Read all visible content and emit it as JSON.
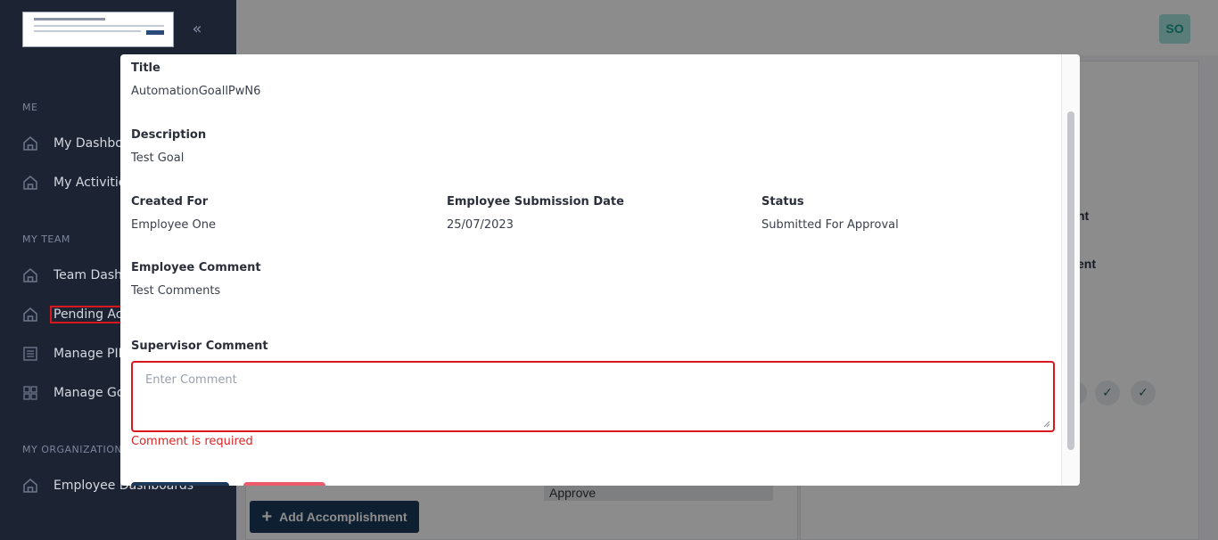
{
  "sidebar": {
    "sections": {
      "me": "ME",
      "my_team": "MY TEAM",
      "my_org": "MY ORGANIZATION"
    },
    "items": [
      {
        "label": "My Dashboard",
        "icon": "home-icon"
      },
      {
        "label": "My Activities",
        "icon": "home-icon"
      },
      {
        "label": "Team Dashboard",
        "icon": "home-icon"
      },
      {
        "label": "Pending Actions",
        "icon": "home-icon"
      },
      {
        "label": "Manage PIP",
        "icon": "list-icon"
      },
      {
        "label": "Manage Goals",
        "icon": "grid-icon"
      },
      {
        "label": "Employee Dashboards",
        "icon": "home-icon"
      }
    ],
    "collapse_glyph": "«"
  },
  "header": {
    "avatar_initials": "SO"
  },
  "background": {
    "frag_1": "nt",
    "frag_2": "ent",
    "approve_label": "Approve",
    "add_accomplishment_label": "Add Accomplishment",
    "plus_glyph": "+"
  },
  "modal": {
    "title_label": "Title",
    "title_value": "AutomationGoallPwN6",
    "description_label": "Description",
    "description_value": "Test Goal",
    "created_for_label": "Created For",
    "created_for_value": "Employee One",
    "submission_date_label": "Employee Submission Date",
    "submission_date_value": "25/07/2023",
    "status_label": "Status",
    "status_value": "Submitted For Approval",
    "employee_comment_label": "Employee Comment",
    "employee_comment_value": "Test Comments",
    "supervisor_comment_label": "Supervisor Comment",
    "supervisor_comment_placeholder": "Enter Comment",
    "error_message": "Comment is required"
  },
  "colors": {
    "sidebar_bg": "#1c2333",
    "error_red": "#d9171c",
    "primary_navy": "#1b3a5a",
    "avatar_teal": "#a6e3dd"
  }
}
